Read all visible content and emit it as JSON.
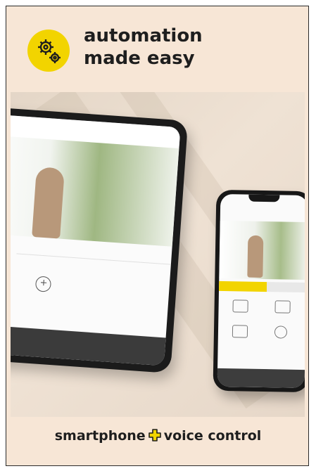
{
  "header": {
    "title_line1": "automation",
    "title_line2": "made easy",
    "badge_icon": "gears-icon",
    "badge_color": "#f2d400"
  },
  "image": {
    "description_icon": "devices-photo"
  },
  "footer": {
    "text_left": "smartphone",
    "plus_icon": "plus-icon",
    "plus_color": "#f2d400",
    "text_right": "voice control"
  },
  "colors": {
    "background": "#f7e6d6",
    "text": "#1e1e1e",
    "accent": "#f2d400"
  }
}
